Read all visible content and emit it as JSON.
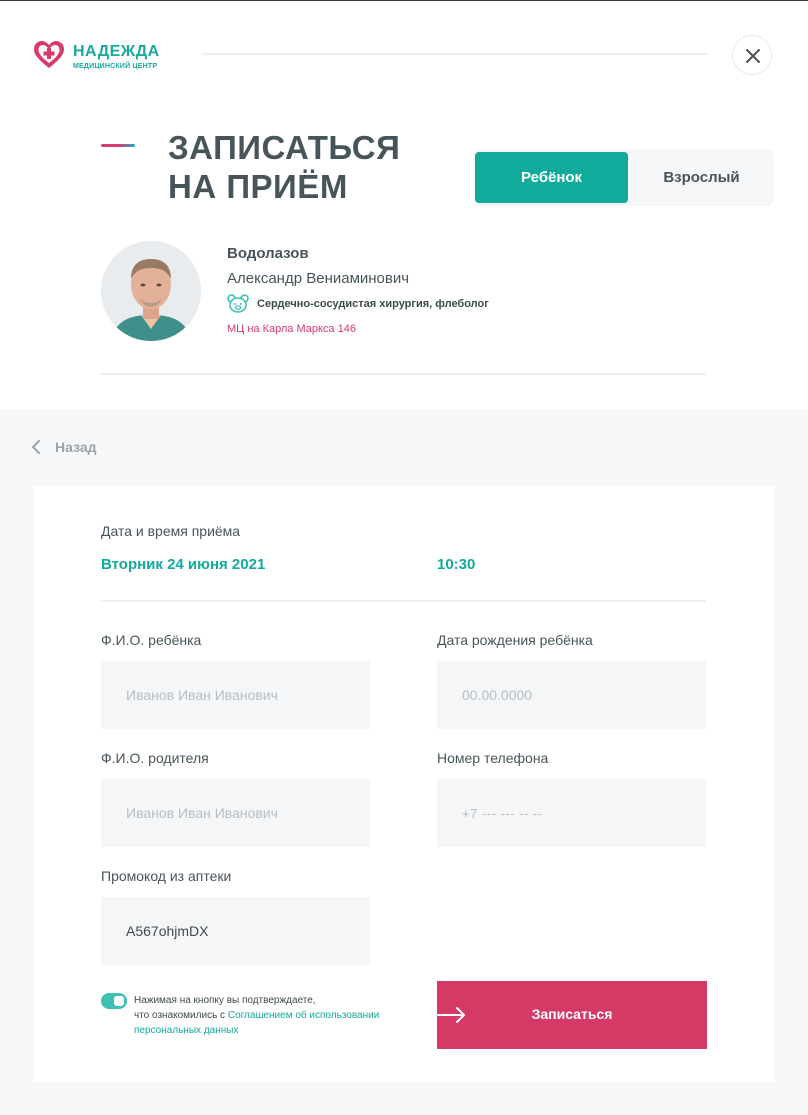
{
  "header": {
    "logo_name": "НАДЕЖДА",
    "logo_subtitle": "МЕДИЦИНСКИЙ ЦЕНТР",
    "close_icon": "close-icon"
  },
  "title": {
    "line1": "ЗАПИСАТЬСЯ",
    "line2": "НА ПРИЁМ"
  },
  "patient_type": {
    "child_label": "Ребёнок",
    "adult_label": "Взрослый",
    "selected": "Ребёнок"
  },
  "doctor": {
    "surname": "Водолазов",
    "name": "Александр Вениаминович",
    "specialty_icon": "bear-face-icon",
    "specialty": "Сердечно-сосудистая хирургия, флеболог",
    "clinic": "МЦ на Карла Маркса 146"
  },
  "back_label": "Назад",
  "appointment": {
    "label": "Дата и время приёма",
    "date": "Вторник 24 июня 2021",
    "time": "10:30"
  },
  "form": {
    "child_name_label": "Ф.И.О. ребёнка",
    "child_name_placeholder": "Иванов Иван Иванович",
    "child_birth_label": "Дата рождения ребёнка",
    "child_birth_placeholder": "00.00.0000",
    "parent_name_label": "Ф.И.О. родителя",
    "parent_name_placeholder": "Иванов Иван Иванович",
    "phone_label": "Номер телефона",
    "phone_placeholder": "+7 --- --- -- --",
    "promo_label": "Промокод из аптеки",
    "promo_value": "A567ohjmDX"
  },
  "consent": {
    "enabled": true,
    "text_line1": "Нажимая на кнопку вы подтверждаете,",
    "text_line2_prefix": "что ознакомились с ",
    "link_text": "Соглашением об использовании персональных данных"
  },
  "submit": {
    "label": "Записаться",
    "icon": "arrow-right-icon"
  },
  "colors": {
    "teal": "#12aa9b",
    "pink": "#d53a66",
    "heading": "#47555a",
    "panel_bg": "#f7f8fa",
    "field_bg": "#f5f6f8"
  }
}
